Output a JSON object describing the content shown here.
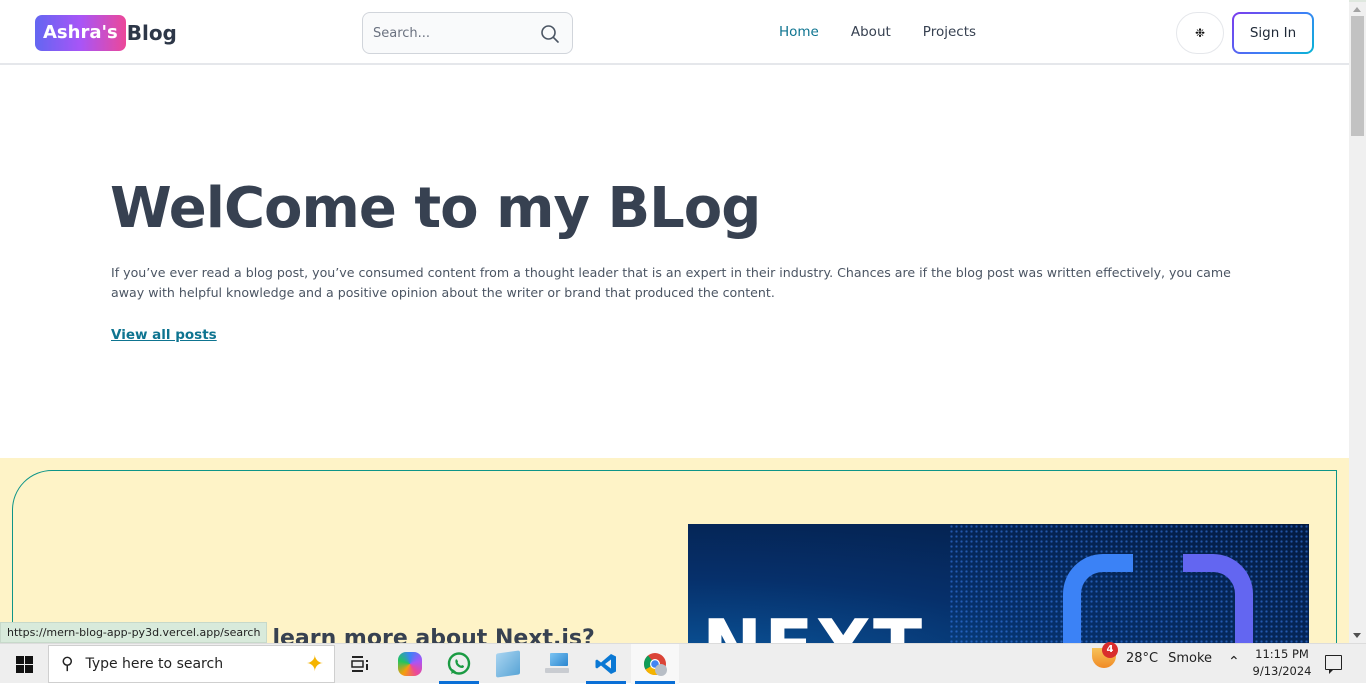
{
  "header": {
    "logo_badge": "Ashra's",
    "logo_text": "Blog",
    "search_placeholder": "Search...",
    "nav": [
      {
        "label": "Home",
        "active": true
      },
      {
        "label": "About",
        "active": false
      },
      {
        "label": "Projects",
        "active": false
      }
    ],
    "theme_toggle_icon": "sun-icon",
    "sign_in_label": "Sign In"
  },
  "hero": {
    "title": "WelCome to my BLog",
    "description": "If you’ve ever read a blog post, you’ve consumed content from a thought leader that is an expert in their industry. Chances are if the blog post was written effectively, you came away with helpful knowledge and a positive opinion about the writer or brand that produced the content.",
    "view_all_label": "View all posts"
  },
  "promo": {
    "heading": "Want to learn more about Next.js?",
    "image_text": "NEXT",
    "image_alt": "Next.js promo image"
  },
  "status_bar": {
    "url": "https://mern-blog-app-py3d.vercel.app/search"
  },
  "colors": {
    "accent": "#0e7490",
    "promo_bg": "#fef3c7",
    "promo_border": "#0d9488",
    "heading": "#374151"
  },
  "taskbar": {
    "search_placeholder": "Type here to search",
    "apps": [
      {
        "name": "task-view",
        "icon": "task-view-icon"
      },
      {
        "name": "copilot",
        "icon": "copilot-icon"
      },
      {
        "name": "whatsapp",
        "icon": "whatsapp-icon",
        "running": true
      },
      {
        "name": "notepad",
        "icon": "notepad-icon"
      },
      {
        "name": "this-pc",
        "icon": "computer-icon"
      },
      {
        "name": "vscode",
        "icon": "vscode-icon",
        "running": true
      },
      {
        "name": "chrome",
        "icon": "chrome-icon",
        "running": true,
        "focused": true
      }
    ],
    "weather": {
      "badge": "4",
      "temp": "28°C",
      "condition": "Smoke"
    },
    "time": "11:15 PM",
    "date": "9/13/2024"
  }
}
